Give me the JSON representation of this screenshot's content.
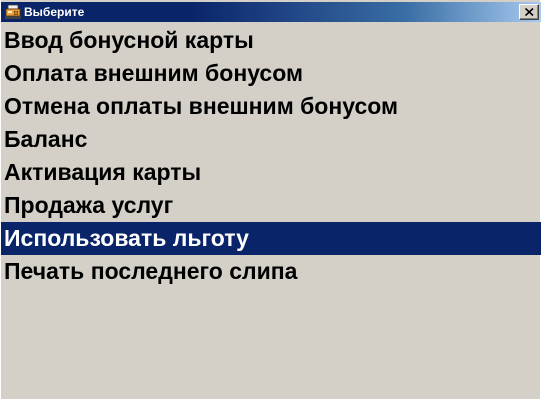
{
  "window": {
    "title": "Выберите",
    "icon": "cash-register-icon",
    "close_icon": "close-icon"
  },
  "menu": {
    "items": [
      {
        "label": "Ввод бонусной карты",
        "selected": false
      },
      {
        "label": "Оплата внешним бонусом",
        "selected": false
      },
      {
        "label": "Отмена оплаты внешним бонусом",
        "selected": false
      },
      {
        "label": "Баланс",
        "selected": false
      },
      {
        "label": "Активация карты",
        "selected": false
      },
      {
        "label": "Продажа услуг",
        "selected": false
      },
      {
        "label": "Использовать льготу",
        "selected": true
      },
      {
        "label": "Печать последнего слипа",
        "selected": false
      }
    ]
  },
  "colors": {
    "titlebar": "#0a246a",
    "selection": "#0a246a",
    "window_bg": "#d4d0c8"
  }
}
